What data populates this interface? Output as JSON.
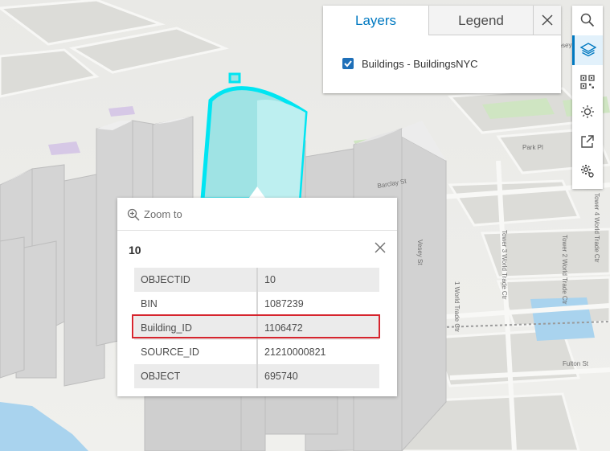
{
  "layer_panel": {
    "tabs": [
      {
        "label": "Layers",
        "active": true
      },
      {
        "label": "Legend",
        "active": false
      }
    ],
    "layers": [
      {
        "label": "Buildings - BuildingsNYC",
        "checked": true
      }
    ],
    "close_icon": "close-icon"
  },
  "toolbar": {
    "tools": [
      {
        "icon": "search-icon"
      },
      {
        "icon": "layers-icon",
        "active": true
      },
      {
        "icon": "qr-code-icon"
      },
      {
        "icon": "daylight-icon"
      },
      {
        "icon": "share-icon"
      },
      {
        "icon": "settings-icon"
      }
    ]
  },
  "popup": {
    "zoom_label": "Zoom to",
    "title": "10",
    "attributes": [
      {
        "key": "OBJECTID",
        "value": "10"
      },
      {
        "key": "BIN",
        "value": "1087239"
      },
      {
        "key": "Building_ID",
        "value": "1106472",
        "highlighted": true
      },
      {
        "key": "SOURCE_ID",
        "value": "21210000821"
      },
      {
        "key": "OBJECT",
        "value": "695740"
      }
    ]
  },
  "map": {
    "street_labels": [
      "Park Pl",
      "Barclay St",
      "Vesey St",
      "Tower 2 World Trade Ctr",
      "1 World Trade Ctr",
      "Tower 3 World Trade Ctr",
      "Vesey St",
      "Fulton St",
      "Tower 4 World Trade Ctr"
    ],
    "colors": {
      "selected_building": "#9fe3e4",
      "selection_outline": "#00e5f2",
      "water": "#a9d3ee",
      "accent": "#0079c1",
      "highlight": "#d6252e"
    }
  }
}
